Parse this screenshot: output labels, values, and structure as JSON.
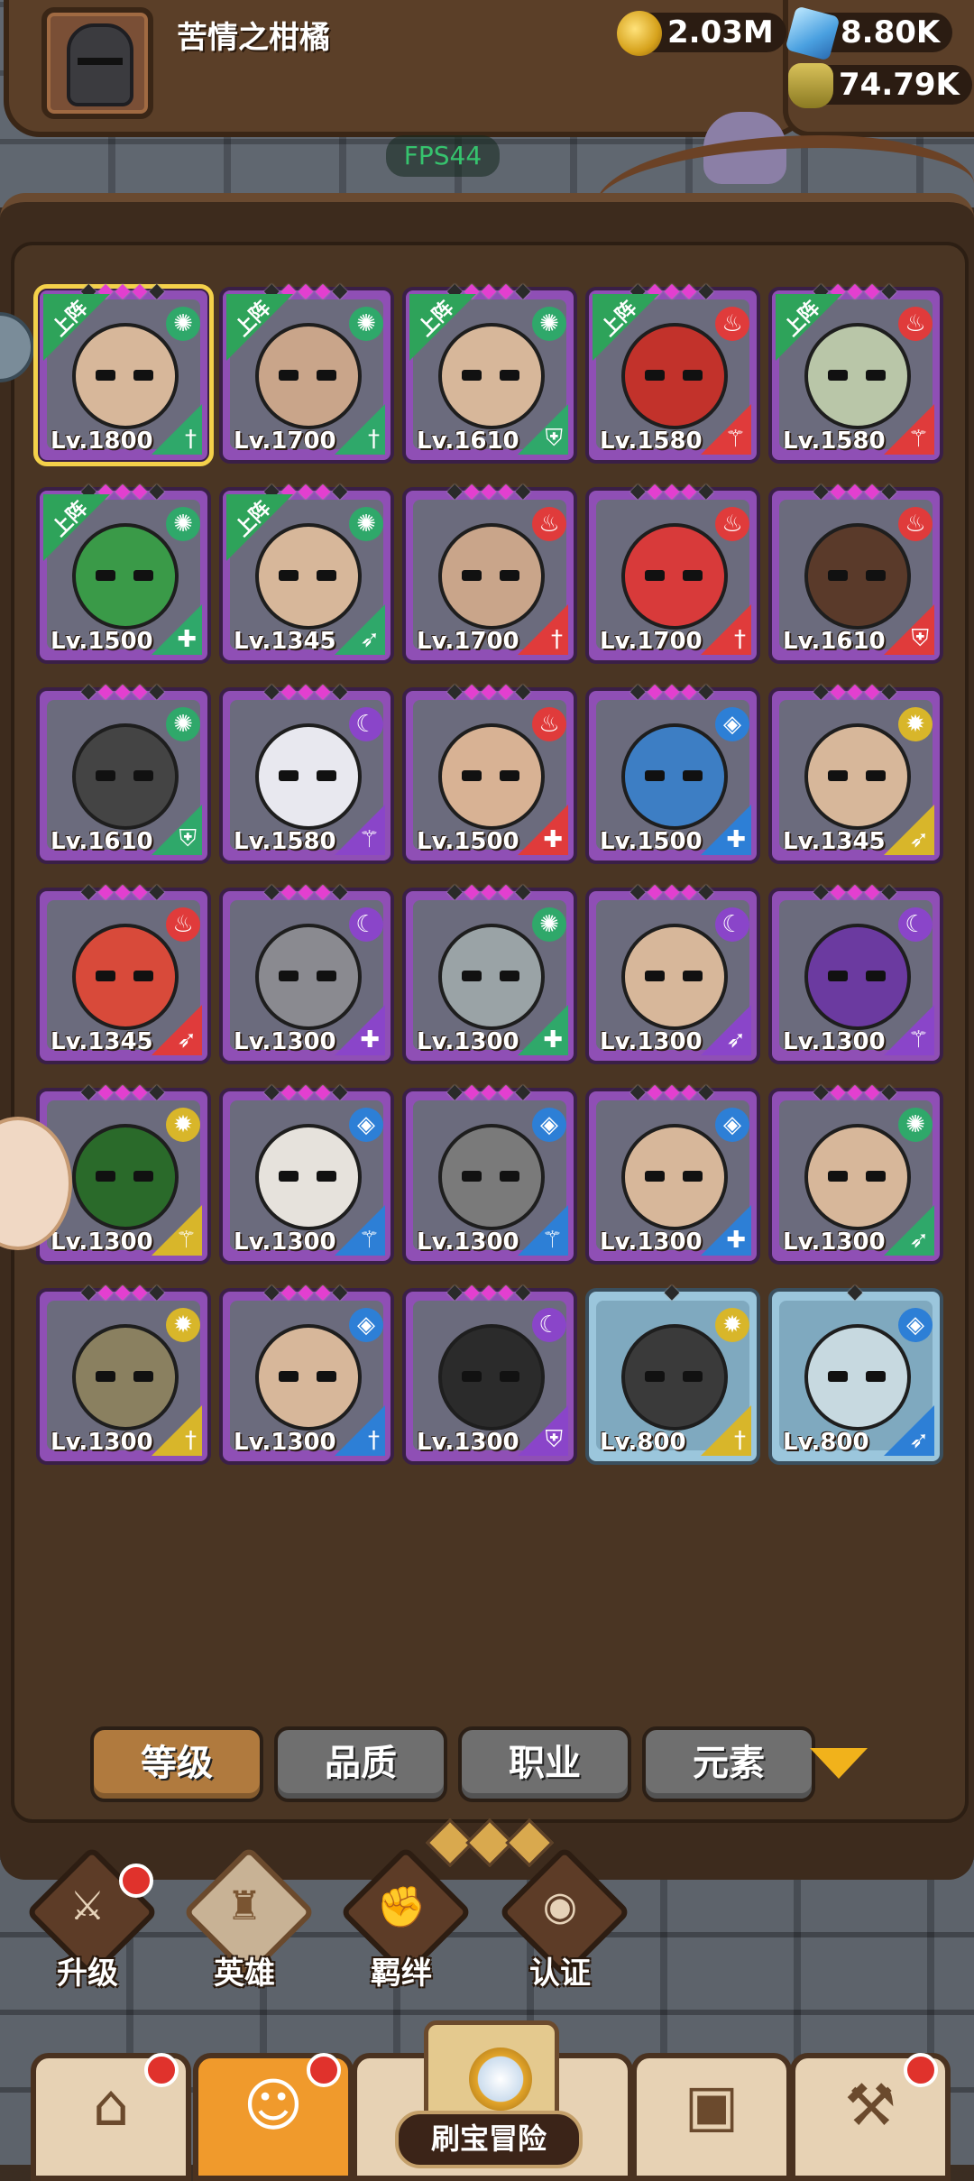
{
  "player": {
    "name": "苦情之柑橘"
  },
  "resources": {
    "gold": "2.03M",
    "gems": "8.80K",
    "potion": "74.79K"
  },
  "fps": "FPS44",
  "heroes": [
    {
      "level": "Lv.1800",
      "element": "wind",
      "class": "sword",
      "deployed": true,
      "quality": "purple",
      "selected": true,
      "stars": "◆◆◆◆◆",
      "skin": "#d7b79a"
    },
    {
      "level": "Lv.1700",
      "element": "wind",
      "class": "sword",
      "deployed": true,
      "quality": "purple",
      "stars": "◆◆◆◆◆",
      "skin": "#c9a58a"
    },
    {
      "level": "Lv.1610",
      "element": "wind",
      "class": "shield",
      "deployed": true,
      "quality": "purple",
      "stars": "◆◆◆◆◆",
      "skin": "#d7b79a"
    },
    {
      "level": "Lv.1580",
      "element": "fire",
      "class": "staff",
      "deployed": true,
      "quality": "purple",
      "stars": "◆◆◆◆◆",
      "skin": "#c2322b"
    },
    {
      "level": "Lv.1580",
      "element": "fire",
      "class": "staff",
      "deployed": true,
      "quality": "purple",
      "stars": "◆◆◆◆◆",
      "skin": "#b9c6a8"
    },
    {
      "level": "Lv.1500",
      "element": "wind",
      "class": "heal",
      "deployed": true,
      "quality": "purple",
      "stars": "◆◆◆◆◆",
      "skin": "#3a9a48"
    },
    {
      "level": "Lv.1345",
      "element": "wind",
      "class": "bow",
      "deployed": true,
      "quality": "purple",
      "stars": "◆◆◆◆◆",
      "skin": "#d7b79a"
    },
    {
      "level": "Lv.1700",
      "element": "fire",
      "class": "sword",
      "deployed": false,
      "quality": "purple",
      "stars": "◆◆◆◆◆",
      "skin": "#c9a58a"
    },
    {
      "level": "Lv.1700",
      "element": "fire",
      "class": "sword",
      "deployed": false,
      "quality": "purple",
      "stars": "◆◆◆◆◆",
      "skin": "#d83a3a"
    },
    {
      "level": "Lv.1610",
      "element": "fire",
      "class": "shield",
      "deployed": false,
      "quality": "purple",
      "stars": "◆◆◆◆◆",
      "skin": "#5a3a2a"
    },
    {
      "level": "Lv.1610",
      "element": "wind",
      "class": "shield",
      "deployed": false,
      "quality": "purple",
      "stars": "◆◆◆◆◆",
      "skin": "#444"
    },
    {
      "level": "Lv.1580",
      "element": "dark",
      "class": "staff",
      "deployed": false,
      "quality": "purple",
      "stars": "◆◆◆◆◆",
      "skin": "#e8e8ef"
    },
    {
      "level": "Lv.1500",
      "element": "fire",
      "class": "heal",
      "deployed": false,
      "quality": "purple",
      "stars": "◆◆◆◆◆",
      "skin": "#d8b294"
    },
    {
      "level": "Lv.1500",
      "element": "water",
      "class": "heal",
      "deployed": false,
      "quality": "purple",
      "stars": "◆◆◆◆◆",
      "skin": "#3d7ec4"
    },
    {
      "level": "Lv.1345",
      "element": "light",
      "class": "bow",
      "deployed": false,
      "quality": "purple",
      "stars": "◆◆◆◆◆",
      "skin": "#d7b79a"
    },
    {
      "level": "Lv.1345",
      "element": "fire",
      "class": "bow",
      "deployed": false,
      "quality": "purple",
      "stars": "◆◆◆◆◆",
      "skin": "#d84a3a"
    },
    {
      "level": "Lv.1300",
      "element": "dark",
      "class": "heal",
      "deployed": false,
      "quality": "purple",
      "stars": "◆◆◆◆◆",
      "skin": "#8a8a90"
    },
    {
      "level": "Lv.1300",
      "element": "wind",
      "class": "heal",
      "deployed": false,
      "quality": "purple",
      "stars": "◆◆◆◆◆",
      "skin": "#9aa3a6"
    },
    {
      "level": "Lv.1300",
      "element": "dark",
      "class": "bow",
      "deployed": false,
      "quality": "purple",
      "stars": "◆◆◆◆◆",
      "skin": "#d7b79a"
    },
    {
      "level": "Lv.1300",
      "element": "dark",
      "class": "staff",
      "deployed": false,
      "quality": "purple",
      "stars": "◆◆◆◆◆",
      "skin": "#6b3aa0"
    },
    {
      "level": "Lv.1300",
      "element": "light",
      "class": "staff",
      "deployed": false,
      "quality": "purple",
      "stars": "◆◆◆◆◆",
      "skin": "#2a6a2a"
    },
    {
      "level": "Lv.1300",
      "element": "water",
      "class": "staff",
      "deployed": false,
      "quality": "purple",
      "stars": "◆◆◆◆◆",
      "skin": "#e6e2dc"
    },
    {
      "level": "Lv.1300",
      "element": "water",
      "class": "staff",
      "deployed": false,
      "quality": "purple",
      "stars": "◆◆◆◆◆",
      "skin": "#7a7a7a"
    },
    {
      "level": "Lv.1300",
      "element": "water",
      "class": "heal",
      "deployed": false,
      "quality": "purple",
      "stars": "◆◆◆◆◆",
      "skin": "#d7b79a"
    },
    {
      "level": "Lv.1300",
      "element": "wind",
      "class": "bow",
      "deployed": false,
      "quality": "purple",
      "stars": "◆◆◆◆◆",
      "skin": "#d7b79a"
    },
    {
      "level": "Lv.1300",
      "element": "light",
      "class": "sword",
      "deployed": false,
      "quality": "purple",
      "stars": "◆◆◆◆◆",
      "skin": "#8a8060"
    },
    {
      "level": "Lv.1300",
      "element": "water",
      "class": "sword",
      "deployed": false,
      "quality": "purple",
      "stars": "◆◆◆◆◆",
      "skin": "#d7b79a"
    },
    {
      "level": "Lv.1300",
      "element": "dark",
      "class": "shield",
      "deployed": false,
      "quality": "purple",
      "stars": "◆◆◆◆◆",
      "skin": "#2b2b2b"
    },
    {
      "level": "Lv.800",
      "element": "light",
      "class": "sword",
      "deployed": false,
      "quality": "blue",
      "stars": "◆",
      "skin": "#3a3a3a"
    },
    {
      "level": "Lv.800",
      "element": "water",
      "class": "bow",
      "deployed": false,
      "quality": "blue",
      "stars": "◆",
      "skin": "#c7d9e0"
    }
  ],
  "deployed_label": "上阵",
  "filters": {
    "level": "等级",
    "quality": "品质",
    "class": "职业",
    "element": "元素"
  },
  "subnav": {
    "upgrade": "升级",
    "heroes": "英雄",
    "bond": "羁绊",
    "certify": "认证"
  },
  "bottomnav": {
    "adventure": "刷宝冒险"
  },
  "colors": {
    "accent": "#b07a3e",
    "panel": "#3d2b1d",
    "notification": "#e0322c"
  }
}
